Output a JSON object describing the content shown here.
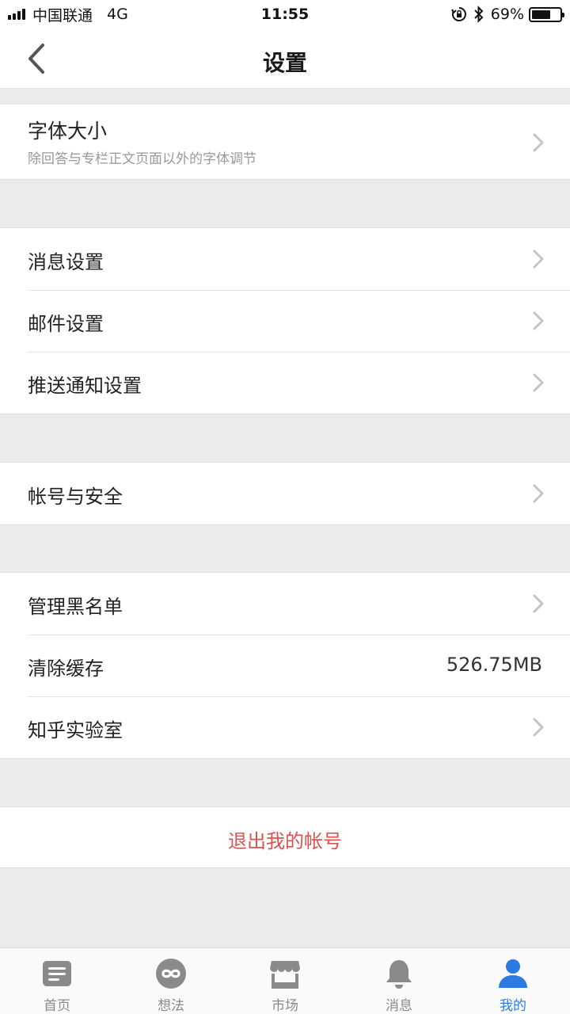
{
  "status_bar": {
    "carrier": "中国联通",
    "network": "4G",
    "time": "11:55",
    "battery": "69%",
    "battery_level": 0.69,
    "icons": [
      "signal-icon",
      "orientation-lock-icon",
      "bluetooth-icon",
      "battery-icon"
    ]
  },
  "nav": {
    "title": "设置",
    "back_icon": "chevron-left-icon"
  },
  "font_size_row": {
    "label": "字体大小",
    "subtitle": "除回答与专栏正文页面以外的字体调节"
  },
  "notifications_group": {
    "items": [
      {
        "label": "消息设置"
      },
      {
        "label": "邮件设置"
      },
      {
        "label": "推送通知设置"
      }
    ]
  },
  "account_group": {
    "items": [
      {
        "label": "帐号与安全"
      }
    ]
  },
  "misc_group": {
    "items": [
      {
        "label": "管理黑名单"
      },
      {
        "label": "清除缓存",
        "value": "526.75MB"
      },
      {
        "label": "知乎实验室"
      }
    ]
  },
  "logout": {
    "label": "退出我的帐号",
    "color": "#d9534f"
  },
  "tabs": [
    {
      "label": "首页",
      "icon": "home-feed-icon",
      "active": false
    },
    {
      "label": "想法",
      "icon": "ideas-icon",
      "active": false
    },
    {
      "label": "市场",
      "icon": "market-icon",
      "active": false
    },
    {
      "label": "消息",
      "icon": "bell-icon",
      "active": false
    },
    {
      "label": "我的",
      "icon": "profile-icon",
      "active": true
    }
  ],
  "colors": {
    "accent": "#2c7be5",
    "inactive_tab": "#8a8a8a",
    "background": "#ebebeb",
    "logout": "#d9534f"
  }
}
